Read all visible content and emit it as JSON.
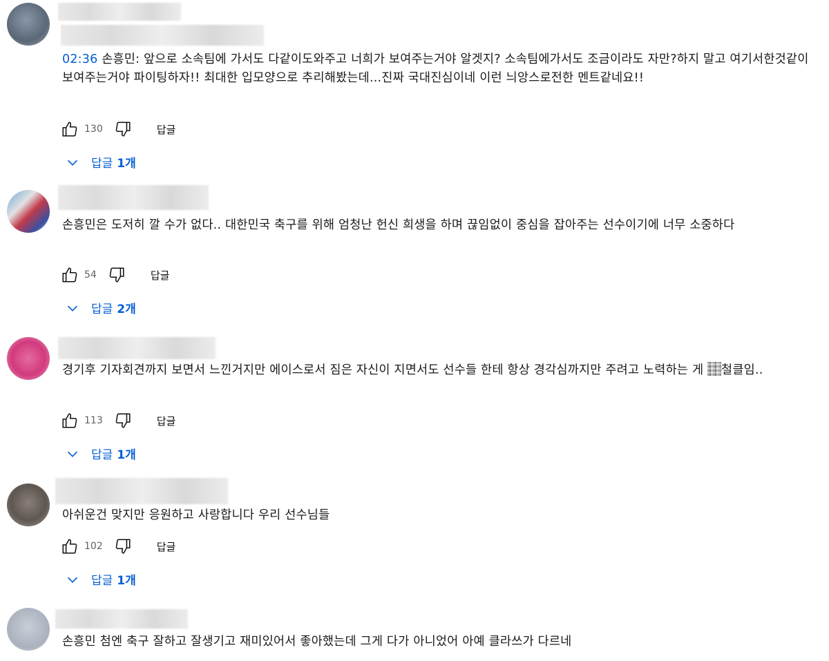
{
  "comments": [
    {
      "timestamp": "02:36",
      "text": " 손흥민: 앞으로 소속팀에 가서도 다같이도와주고 너희가 보여주는거야 알겟지? 소속팀에가서도 조금이라도 자만?하지 말고 여기서한것같이 보여주는거야 파이팅하자!! 최대한 입모양으로 추리해봤는데...진짜 국대진심이네 이런 늬앙스로전한 멘트같네요!!",
      "likes": "130",
      "reply_label": "답글",
      "replies_label": "답글",
      "replies_count": "1개"
    },
    {
      "timestamp": "",
      "text": "손흥민은 도저히 깔 수가 없다.. 대한민국 축구를 위해 엄청난 헌신 희생을 하며 끊임없이 중심을 잡아주는 선수이기에 너무 소중하다",
      "likes": "54",
      "reply_label": "답글",
      "replies_label": "답글",
      "replies_count": "2개"
    },
    {
      "timestamp": "",
      "text_a": "경기후 기자회견까지 보면서 느낀거지만 에이스로서 짐은 자신이 지면서도 선수들 한테 항상 경각심까지만 주려고 노력하는 게 ",
      "text_b": "철클임..",
      "likes": "113",
      "reply_label": "답글",
      "replies_label": "답글",
      "replies_count": "1개"
    },
    {
      "timestamp": "",
      "text": "아쉬운건 맞지만 응원하고 사랑합니다 우리 선수님들",
      "likes": "102",
      "reply_label": "답글",
      "replies_label": "답글",
      "replies_count": "1개"
    },
    {
      "timestamp": "",
      "text": "손흥민 첨엔 축구 잘하고 잘생기고 재미있어서 좋아했는데 그게 다가 아니었어 아예 클라쓰가 다르네"
    }
  ],
  "colors": {
    "link": "#065fd4",
    "meta": "#606060",
    "text": "#1a1a1a"
  },
  "icons": {
    "like": "thumbs-up-icon",
    "dislike": "thumbs-down-icon",
    "expand": "chevron-down-icon"
  }
}
